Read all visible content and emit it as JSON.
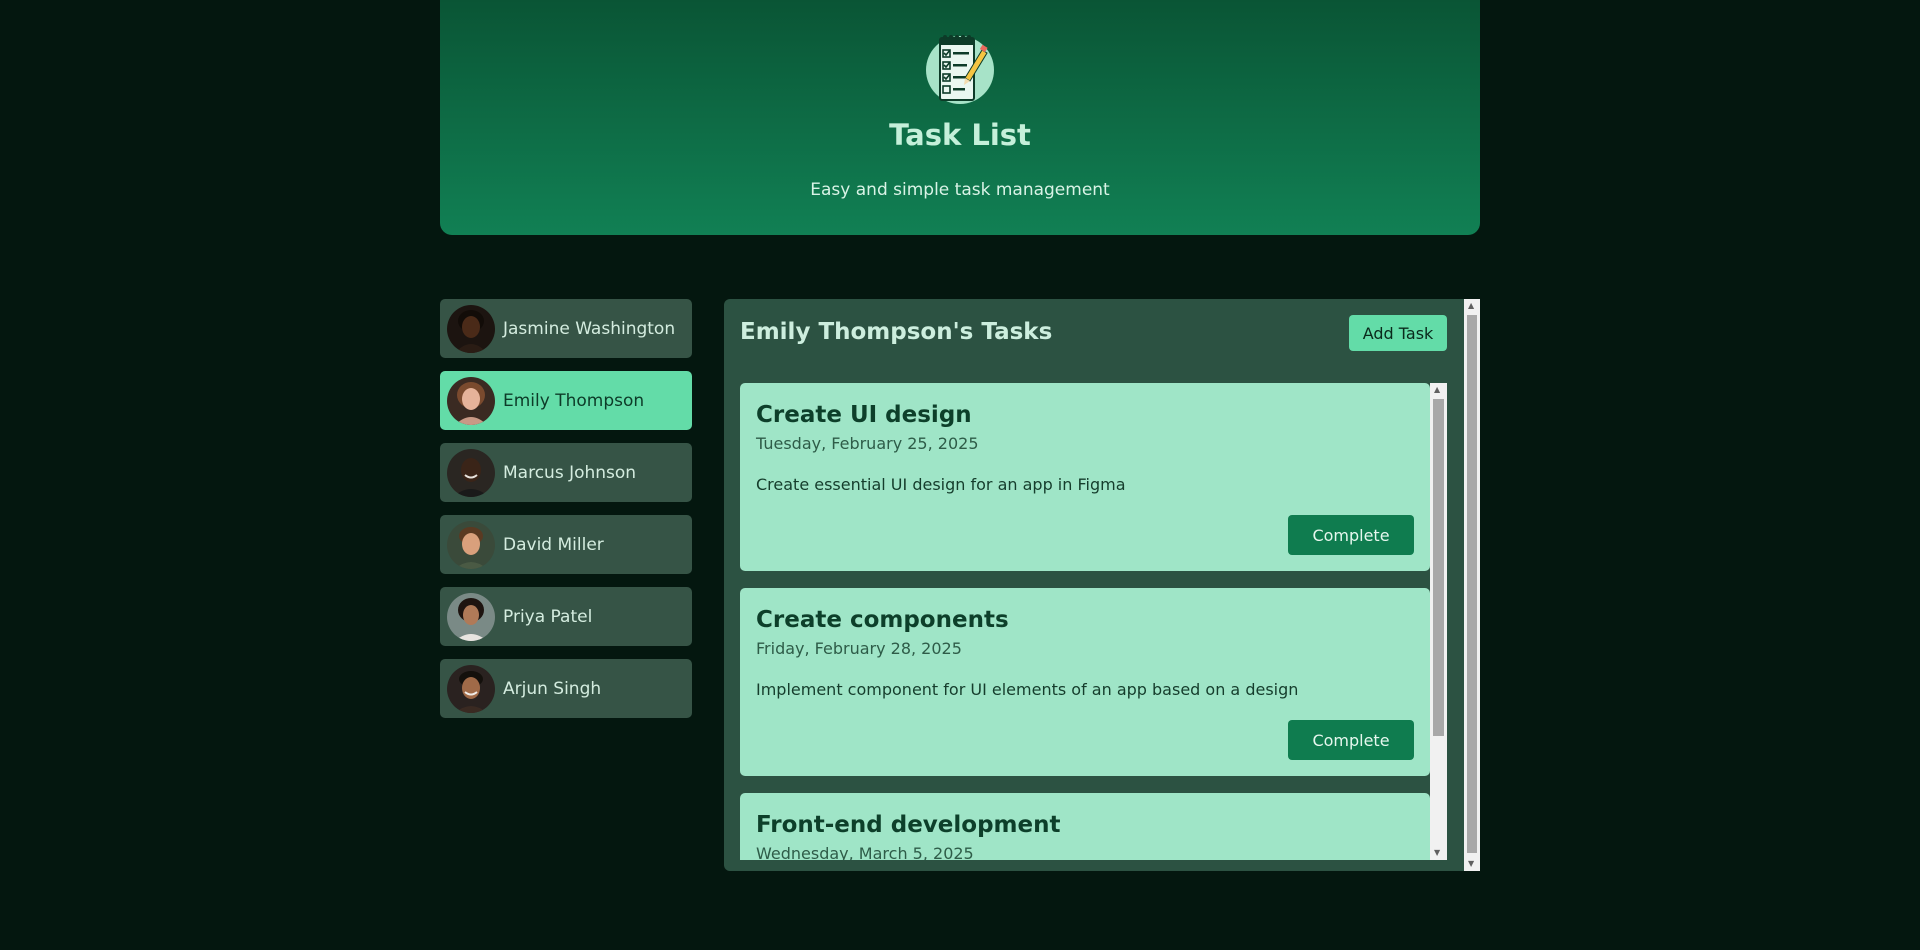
{
  "header": {
    "title": "Task List",
    "subtitle": "Easy and simple task management",
    "logo_icon": "clipboard-checklist-icon"
  },
  "users": [
    {
      "name": "Jasmine Washington",
      "active": false
    },
    {
      "name": "Emily Thompson",
      "active": true
    },
    {
      "name": "Marcus Johnson",
      "active": false
    },
    {
      "name": "David Miller",
      "active": false
    },
    {
      "name": "Priya Patel",
      "active": false
    },
    {
      "name": "Arjun Singh",
      "active": false
    }
  ],
  "panel": {
    "title": "Emily Thompson's Tasks",
    "add_label": "Add Task"
  },
  "tasks": [
    {
      "title": "Create UI design",
      "date": "Tuesday, February 25, 2025",
      "description": "Create essential UI design for an app in Figma",
      "button": "Complete"
    },
    {
      "title": "Create components",
      "date": "Friday, February 28, 2025",
      "description": "Implement component for UI elements of an app based on a design",
      "button": "Complete"
    },
    {
      "title": "Front-end development",
      "date": "Wednesday, March 5, 2025",
      "description": "",
      "button": ""
    }
  ],
  "colors": {
    "background": "#04170f",
    "header": "#118054",
    "accent": "#63dca8",
    "card": "#9fe5c7",
    "button": "#0f7c4f"
  }
}
